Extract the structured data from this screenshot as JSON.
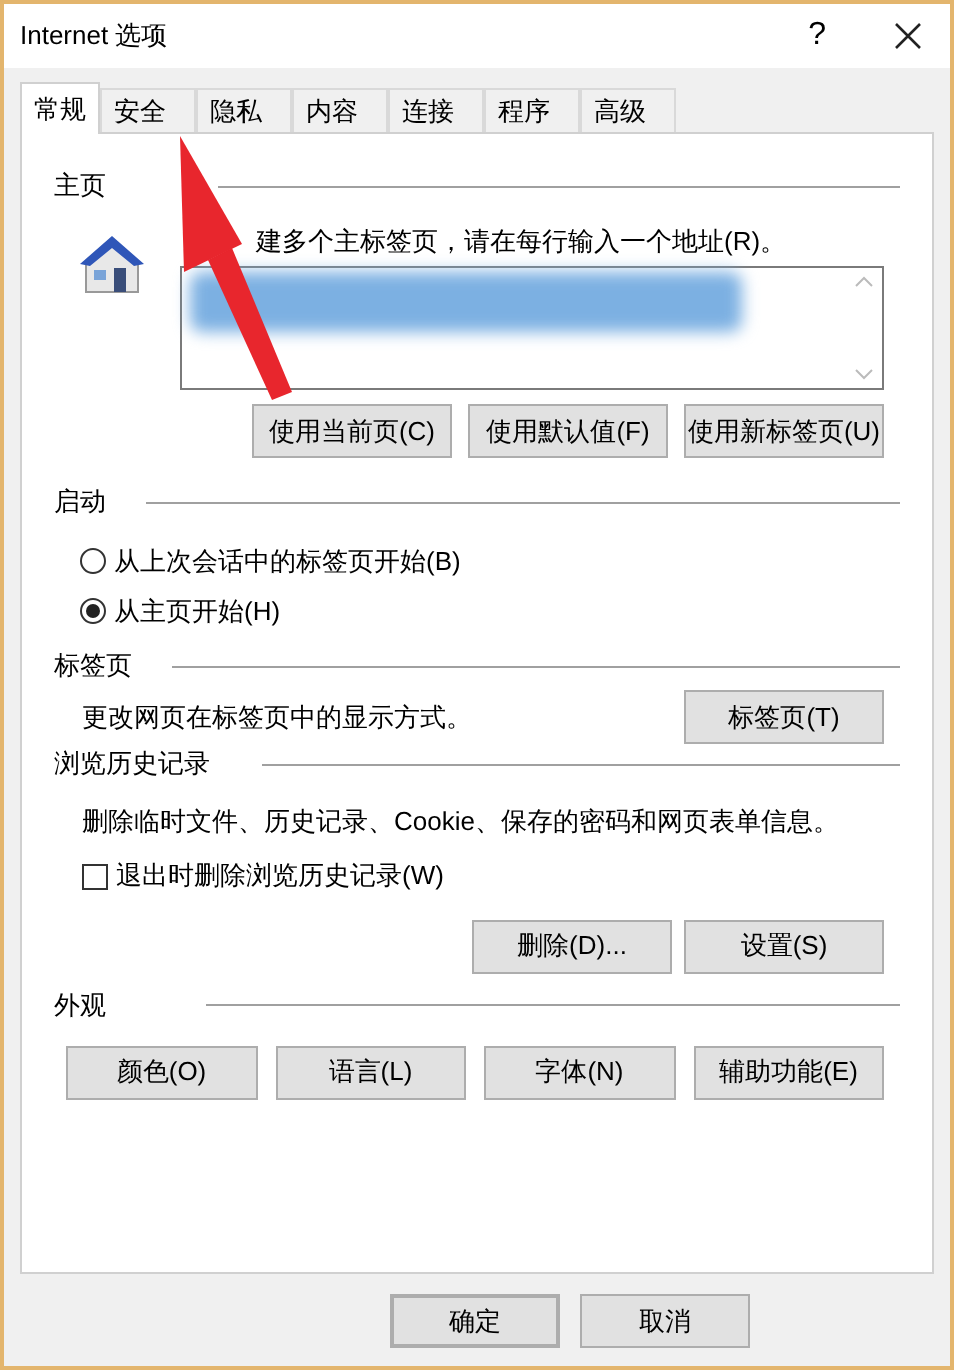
{
  "window": {
    "title": "Internet 选项",
    "help": "?"
  },
  "tabs": [
    {
      "label": "常规",
      "selected": true
    },
    {
      "label": "安全",
      "selected": false
    },
    {
      "label": "隐私",
      "selected": false
    },
    {
      "label": "内容",
      "selected": false
    },
    {
      "label": "连接",
      "selected": false
    },
    {
      "label": "程序",
      "selected": false
    },
    {
      "label": "高级",
      "selected": false
    }
  ],
  "homepage": {
    "heading": "主页",
    "instruction": "建多个主标签页，请在每行输入一个地址(R)。",
    "buttons": [
      "使用当前页(C)",
      "使用默认值(F)",
      "使用新标签页(U)"
    ]
  },
  "startup": {
    "heading": "启动",
    "options": [
      {
        "label": "从上次会话中的标签页开始(B)",
        "selected": false
      },
      {
        "label": "从主页开始(H)",
        "selected": true
      }
    ]
  },
  "tabs_section": {
    "heading": "标签页",
    "description": "更改网页在标签页中的显示方式。",
    "button": "标签页(T)"
  },
  "history": {
    "heading": "浏览历史记录",
    "description": "删除临时文件、历史记录、Cookie、保存的密码和网页表单信息。",
    "checkbox": {
      "label": "退出时删除浏览历史记录(W)",
      "checked": false
    },
    "buttons": [
      "删除(D)...",
      "设置(S)"
    ]
  },
  "appearance": {
    "heading": "外观",
    "buttons": [
      "颜色(O)",
      "语言(L)",
      "字体(N)",
      "辅助功能(E)"
    ]
  },
  "footer_buttons": [
    {
      "label": "确定",
      "default": true
    },
    {
      "label": "取消",
      "default": false
    }
  ]
}
